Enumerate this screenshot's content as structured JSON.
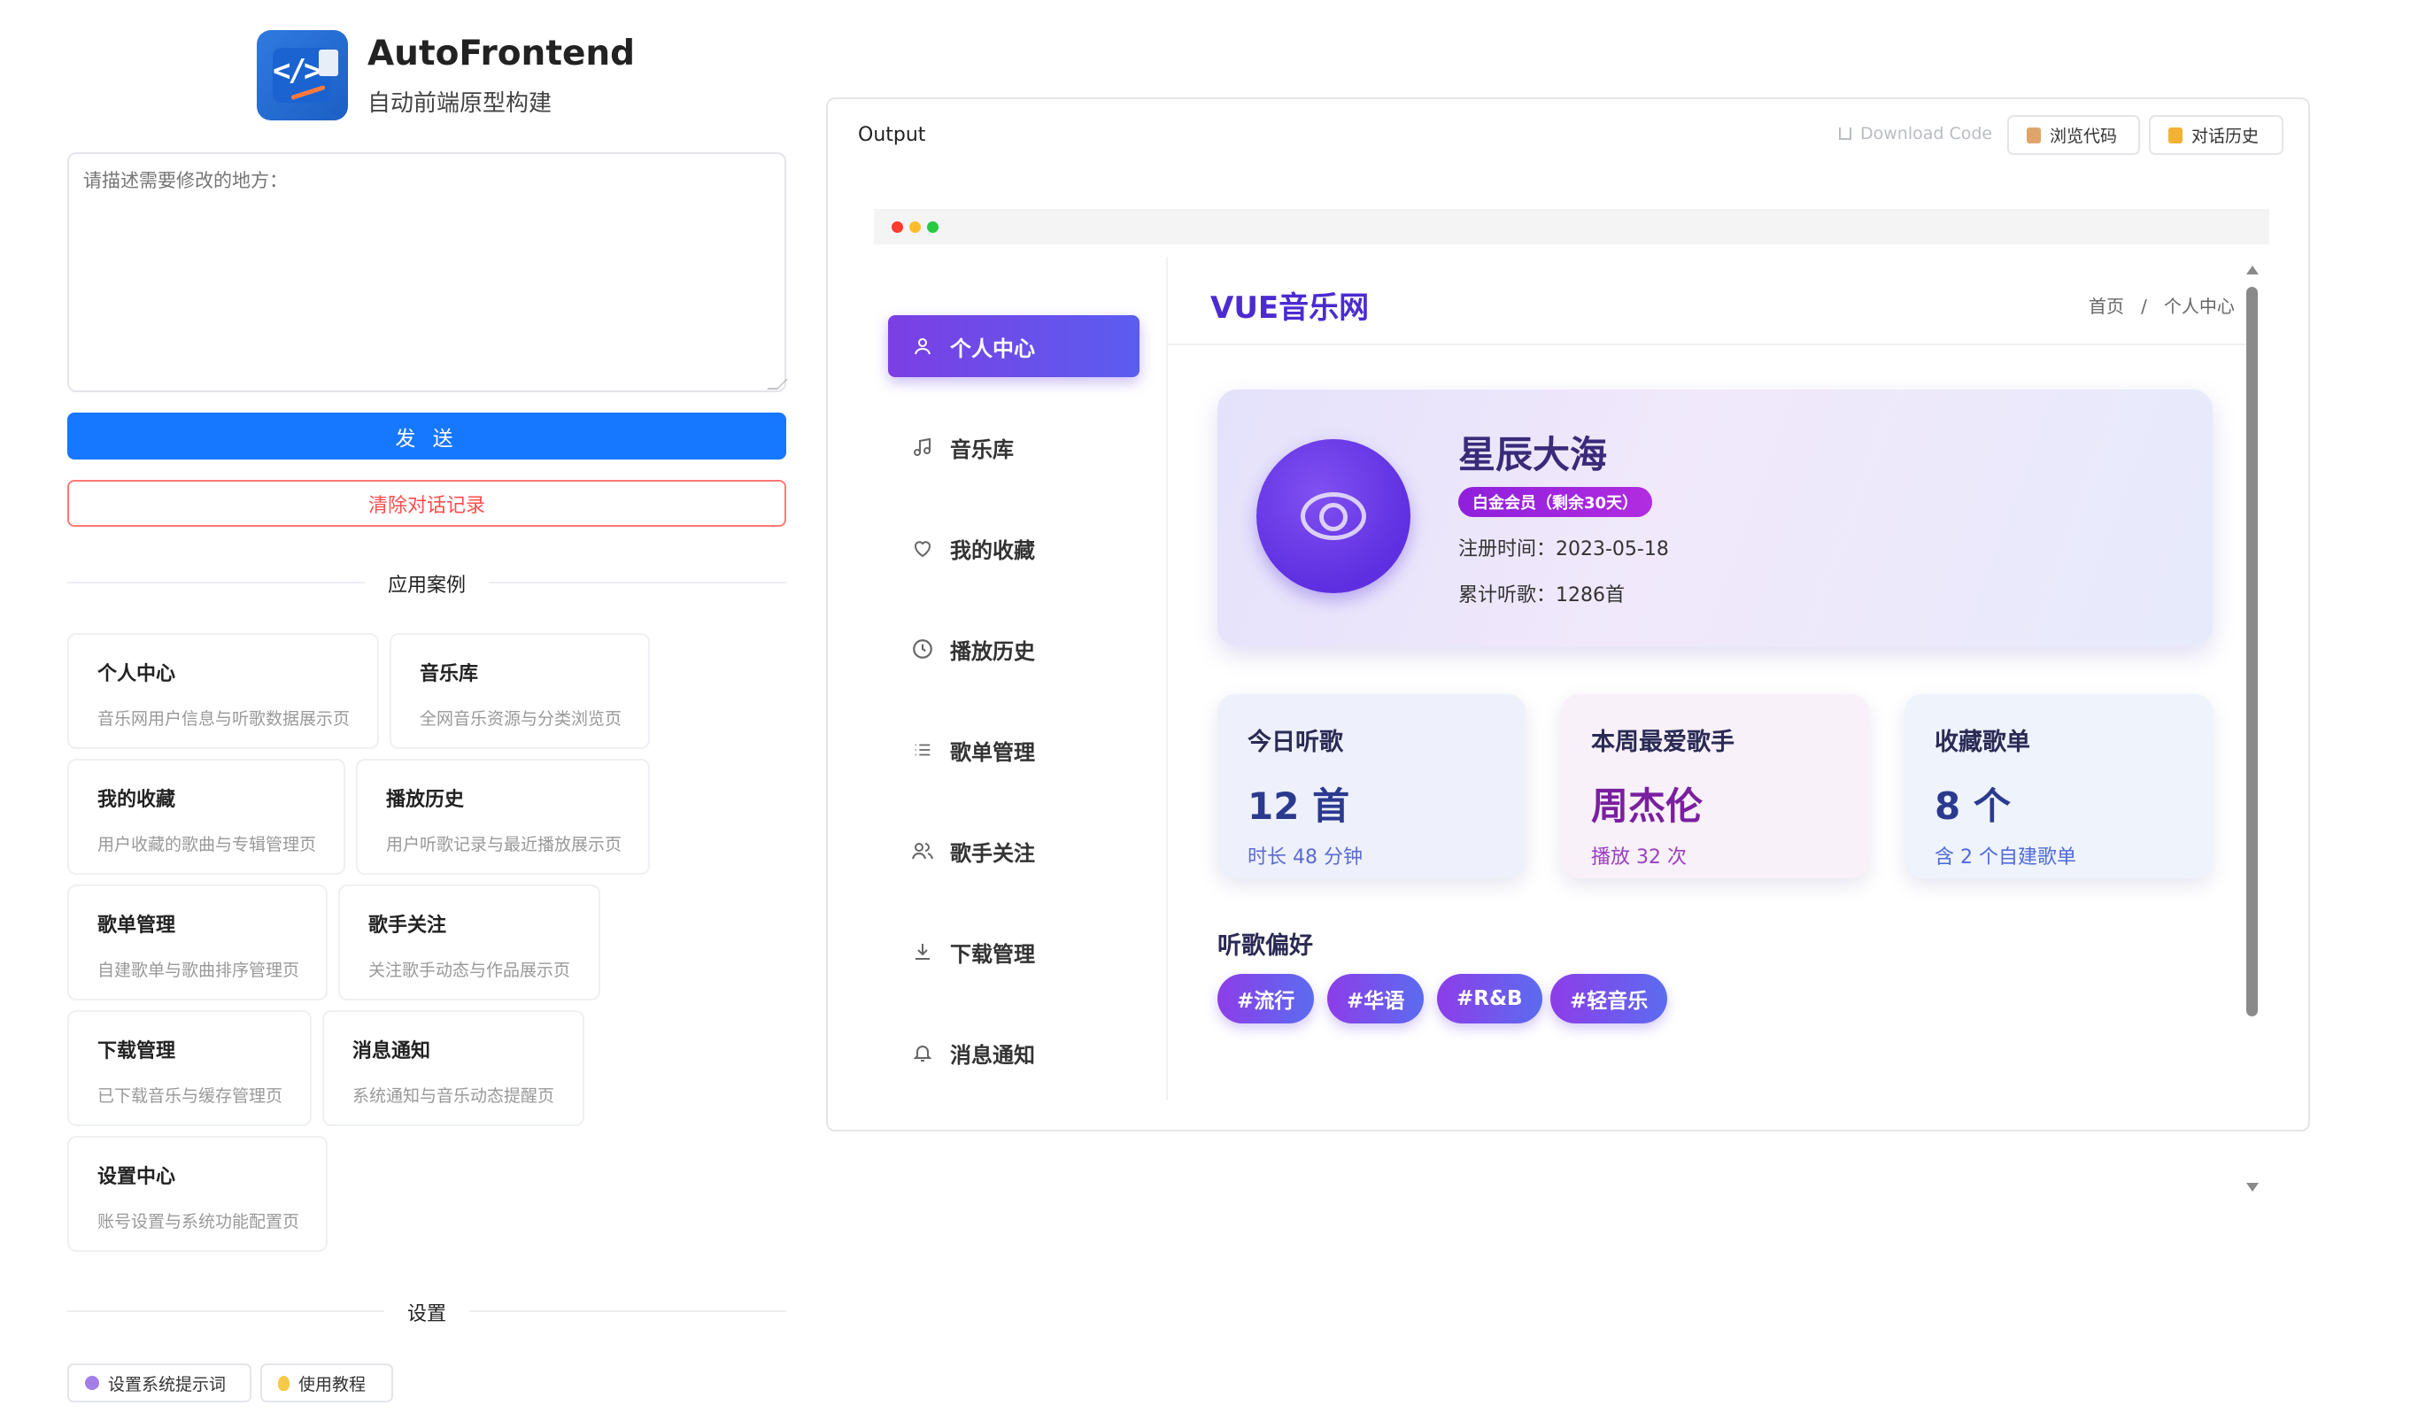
{
  "app": {
    "title": "AutoFrontend",
    "subtitle": "自动前端原型构建"
  },
  "prompt": {
    "placeholder": "请描述需要修改的地方：",
    "value": ""
  },
  "actions": {
    "send_label": "发 送",
    "clear_label": "清除对话记录"
  },
  "cases": {
    "heading": "应用案例",
    "items": [
      {
        "title": "个人中心",
        "desc": "音乐网用户信息与听歌数据展示页"
      },
      {
        "title": "音乐库",
        "desc": "全网音乐资源与分类浏览页"
      },
      {
        "title": "我的收藏",
        "desc": "用户收藏的歌曲与专辑管理页"
      },
      {
        "title": "播放历史",
        "desc": "用户听歌记录与最近播放展示页"
      },
      {
        "title": "歌单管理",
        "desc": "自建歌单与歌曲排序管理页"
      },
      {
        "title": "歌手关注",
        "desc": "关注歌手动态与作品展示页"
      },
      {
        "title": "下载管理",
        "desc": "已下载音乐与缓存管理页"
      },
      {
        "title": "消息通知",
        "desc": "系统通知与音乐动态提醒页"
      },
      {
        "title": "设置中心",
        "desc": "账号设置与系统功能配置页"
      }
    ]
  },
  "settings": {
    "heading": "设置",
    "system_prompt_label": "设置系统提示词",
    "tutorial_label": "使用教程"
  },
  "output": {
    "label": "Output",
    "download_label": "Download Code",
    "browse_code_label": "浏览代码",
    "history_label": "对话历史",
    "window_dot_colors": [
      "#ff3b30",
      "#ffbd2e",
      "#28c840"
    ]
  },
  "preview": {
    "site_title": "VUE音乐网",
    "breadcrumb": {
      "home": "首页",
      "separator": "/",
      "current": "个人中心"
    },
    "nav": [
      {
        "label": "个人中心",
        "icon": "user-icon",
        "active": true
      },
      {
        "label": "音乐库",
        "icon": "music-note-icon",
        "active": false
      },
      {
        "label": "我的收藏",
        "icon": "heart-icon",
        "active": false
      },
      {
        "label": "播放历史",
        "icon": "clock-icon",
        "active": false
      },
      {
        "label": "歌单管理",
        "icon": "list-icon",
        "active": false
      },
      {
        "label": "歌手关注",
        "icon": "users-icon",
        "active": false
      },
      {
        "label": "下载管理",
        "icon": "download-icon",
        "active": false
      },
      {
        "label": "消息通知",
        "icon": "bell-icon",
        "active": false
      }
    ],
    "profile": {
      "name": "星辰大海",
      "vip": "白金会员（剩余30天）",
      "register": "注册时间：2023-05-18",
      "total_listen": "累计听歌：1286首"
    },
    "stats": [
      {
        "label": "今日听歌",
        "value": "12 首",
        "sub": "时长 48 分钟",
        "value_color": "#2b3a8f",
        "sub_color": "#5b6bd0",
        "bg": "#eef1fb"
      },
      {
        "label": "本周最爱歌手",
        "value": "周杰伦",
        "sub": "播放 32 次",
        "value_color": "#7a1fa0",
        "sub_color": "#9a3fc0",
        "bg": "#f8f1fa"
      },
      {
        "label": "收藏歌单",
        "value": "8 个",
        "sub": "含 2 个自建歌单",
        "value_color": "#2b3a8f",
        "sub_color": "#4f6ad8",
        "bg": "#eef3fc"
      }
    ],
    "preferences": {
      "title": "听歌偏好",
      "tags": [
        "#流行",
        "#华语",
        "#R&B",
        "#轻音乐"
      ]
    }
  },
  "colors": {
    "primary": "#1677ff",
    "danger": "#ff4d4f",
    "accent_purple": "#6a3de8"
  }
}
